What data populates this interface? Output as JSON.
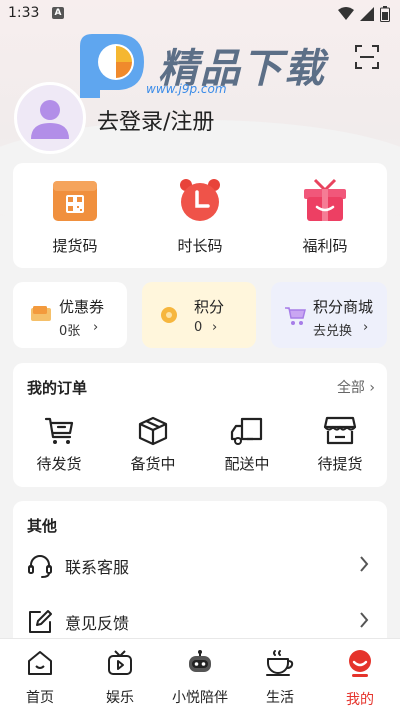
{
  "status_bar": {
    "time": "1:33",
    "notification_badge": "A"
  },
  "watermark": {
    "title": "精品下载",
    "url": "www.j9p.com"
  },
  "profile": {
    "login_text": "去登录/注册"
  },
  "quick_actions": [
    {
      "label": "提货码",
      "icon": "qr-box-icon"
    },
    {
      "label": "时长码",
      "icon": "alarm-clock-icon"
    },
    {
      "label": "福利码",
      "icon": "gift-icon"
    }
  ],
  "mini_cards": {
    "coupon": {
      "title": "优惠券",
      "value": "0张",
      "chevron": "›"
    },
    "points": {
      "title": "积分",
      "value": "0",
      "chevron": "›"
    },
    "mall": {
      "title": "积分商城",
      "value": "去兑换",
      "chevron": "›"
    }
  },
  "orders": {
    "title": "我的订单",
    "all_label": "全部",
    "items": [
      {
        "label": "待发货",
        "icon": "cart-icon"
      },
      {
        "label": "备货中",
        "icon": "package-icon"
      },
      {
        "label": "配送中",
        "icon": "truck-icon"
      },
      {
        "label": "待提货",
        "icon": "store-icon"
      }
    ]
  },
  "other": {
    "title": "其他",
    "items": [
      {
        "label": "联系客服",
        "icon": "headset-icon"
      },
      {
        "label": "意见反馈",
        "icon": "edit-icon"
      }
    ]
  },
  "tabs": [
    {
      "label": "首页",
      "icon": "home-icon"
    },
    {
      "label": "娱乐",
      "icon": "tv-icon"
    },
    {
      "label": "小悦陪伴",
      "icon": "robot-icon"
    },
    {
      "label": "生活",
      "icon": "coffee-icon"
    },
    {
      "label": "我的",
      "icon": "smile-person-icon",
      "active": true
    }
  ],
  "colors": {
    "accent": "#e5332b",
    "coupon_bg": "#ffffff",
    "points_bg": "#fff6dc",
    "mall_bg": "#eef0fb"
  }
}
